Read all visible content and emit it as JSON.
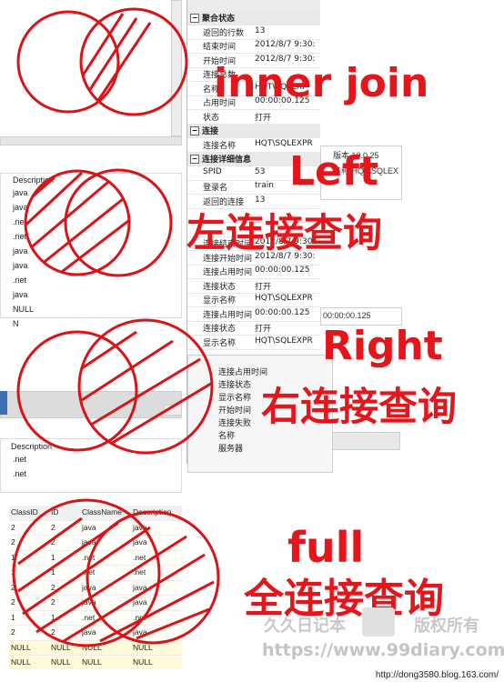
{
  "properties": {
    "rows": [
      {
        "type": "section",
        "key": "聚合状态"
      },
      {
        "key": "返回的行数",
        "value": "13"
      },
      {
        "key": "结束时间",
        "value": "2012/8/7 9:30:"
      },
      {
        "key": "开始时间",
        "value": "2012/8/7 9:30:"
      },
      {
        "key": "连接总数",
        "value": ""
      },
      {
        "key": "名称",
        "value": "HQT\\SQLEXP"
      },
      {
        "key": "占用时间",
        "value": "00:00:00.125"
      },
      {
        "key": "状态",
        "value": "打开"
      },
      {
        "type": "section",
        "key": "连接"
      },
      {
        "key": "连接名称",
        "value": "HQT\\SQLEXPR"
      },
      {
        "type": "section",
        "key": "连接详细信息"
      },
      {
        "key": "SPID",
        "value": "53"
      },
      {
        "key": "登录名",
        "value": "train"
      },
      {
        "key": "返回的连接",
        "value": "13"
      },
      {
        "key": "",
        "value": ""
      },
      {
        "key": "",
        "value": ""
      },
      {
        "key": "连接结束时间",
        "value": "2012/8/7 9:30:"
      },
      {
        "key": "连接开始时间",
        "value": "2012/8/7 9:30:"
      },
      {
        "key": "连接占用时间",
        "value": "00:00:00.125"
      },
      {
        "key": "连接状态",
        "value": "打开"
      },
      {
        "key": "显示名称",
        "value": "HQT\\SQLEXPR"
      },
      {
        "key": "连接占用时间",
        "value": "00:00:00.125"
      },
      {
        "key": "连接状态",
        "value": "打开"
      },
      {
        "key": "显示名称",
        "value": "HQT\\SQLEXPR"
      }
    ],
    "side_values": [
      "版本 10.0.25",
      "名称 HQT\\SQLEX",
      "00:00:00.125"
    ],
    "bottom_keys": [
      "连接占用时间",
      "连接状态",
      "显示名称",
      "开始时间",
      "连接失败",
      "名称",
      "服务器"
    ]
  },
  "labels": {
    "inner_join": "inner join",
    "left_en": "Left",
    "left_cn": "左连接查询",
    "right_en": "Right",
    "right_cn": "右连接查询",
    "full_en": "full",
    "full_cn": "全连接查询"
  },
  "left_grid": {
    "header": "Description",
    "values": [
      "java",
      "java",
      ".net",
      ".net",
      "java",
      "java",
      ".net",
      "java",
      "NULL",
      "N"
    ]
  },
  "right_grid": {
    "header": "Description",
    "values": [
      ".net",
      ".net"
    ]
  },
  "full_table": {
    "headers": [
      "ClassID",
      "ID",
      "ClassName",
      "Description"
    ],
    "rows": [
      [
        "2",
        "2",
        "java",
        "java"
      ],
      [
        "2",
        "2",
        "java",
        "java"
      ],
      [
        "1",
        "1",
        ".net",
        ".net"
      ],
      [
        "1",
        "1",
        ".net",
        ".net"
      ],
      [
        "2",
        "2",
        "java",
        "java"
      ],
      [
        "2",
        "2",
        "java",
        "java"
      ],
      [
        "1",
        "1",
        ".net",
        ".net"
      ],
      [
        "2",
        "2",
        "java",
        "java"
      ],
      [
        "NULL",
        "NULL",
        "NULL",
        "NULL"
      ],
      [
        "NULL",
        "NULL",
        "NULL",
        "NULL"
      ]
    ]
  },
  "watermark": {
    "cn_left": "久久日记本",
    "cn_right": "版权所有",
    "url": "https://www.99diary.com",
    "credit": "http://dong3580.blog.163.com/"
  },
  "colors": {
    "accent": "#e4161b",
    "panel": "#f4f4f4"
  }
}
